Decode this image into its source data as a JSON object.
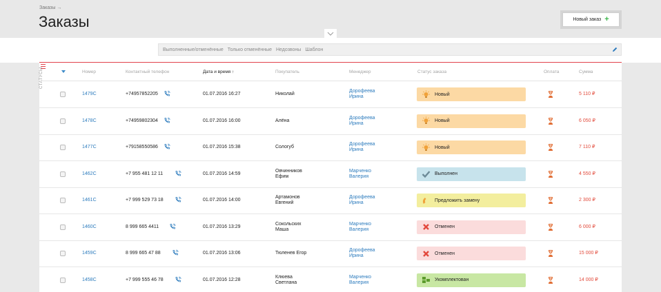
{
  "header": {
    "breadcrumb": "Заказы →",
    "title": "Заказы",
    "new_order_label": "Новый заказ"
  },
  "filters": {
    "tabs": [
      "Выполненные/отменённые",
      "Только отменённые",
      "Недозвоны",
      "Шаблон"
    ]
  },
  "sidebar": {
    "statuses_label": "СТАТУСЫ"
  },
  "table": {
    "headers": {
      "number": "Номер",
      "phone": "Контактный телефон",
      "datetime": "Дата и время ↑",
      "customer": "Покупатель",
      "manager": "Менеджер",
      "status": "Статус заказа",
      "payment": "Оплата",
      "sum": "Сумма"
    },
    "rows": [
      {
        "number": "1479C",
        "phone": "+74957852205",
        "datetime": "01.07.2016 16:27",
        "customer": [
          "Николай"
        ],
        "manager": [
          "Дорофеева",
          "Ирина"
        ],
        "status": "Новый",
        "status_type": "new",
        "sum": "5 110 ₽"
      },
      {
        "number": "1478C",
        "phone": "+74959802304",
        "datetime": "01.07.2016 16:00",
        "customer": [
          "Алёна"
        ],
        "manager": [
          "Дорофеева",
          "Ирина"
        ],
        "status": "Новый",
        "status_type": "new",
        "sum": "6 050 ₽"
      },
      {
        "number": "1477C",
        "phone": "+79158550586",
        "datetime": "01.07.2016 15:38",
        "customer": [
          "Сологуб"
        ],
        "manager": [
          "Дорофеева",
          "Ирина"
        ],
        "status": "Новый",
        "status_type": "new",
        "sum": "7 110 ₽"
      },
      {
        "number": "1462C",
        "phone": "+7 955 481 12 11",
        "datetime": "01.07.2016 14:59",
        "customer": [
          "Овчинников",
          "Ефим"
        ],
        "manager": [
          "Марченко",
          "Валерия"
        ],
        "status": "Выполнен",
        "status_type": "done",
        "sum": "4 550 ₽"
      },
      {
        "number": "1461C",
        "phone": "+7 999 529 73 18",
        "datetime": "01.07.2016 14:00",
        "customer": [
          "Артамонов",
          "Евгений"
        ],
        "manager": [
          "Дорофеева",
          "Ирина"
        ],
        "status": "Предложить замену",
        "status_type": "replace",
        "sum": "2 300 ₽"
      },
      {
        "number": "1460C",
        "phone": "8 999 665 4411",
        "datetime": "01.07.2016 13:29",
        "customer": [
          "Сокольских",
          "Маша"
        ],
        "manager": [
          "Марченко",
          "Валерия"
        ],
        "status": "Отменен",
        "status_type": "cancel",
        "sum": "6 000 ₽"
      },
      {
        "number": "1459C",
        "phone": "8 999 665 47 88",
        "datetime": "01.07.2016 13:06",
        "customer": [
          "Тюленев Егор"
        ],
        "manager": [
          "Дорофеева",
          "Ирина"
        ],
        "status": "Отменен",
        "status_type": "cancel",
        "sum": "15 000 ₽"
      },
      {
        "number": "1458C",
        "phone": "+7 999 555 46 78",
        "datetime": "01.07.2016 12:28",
        "customer": [
          "Клюева",
          "Светлана"
        ],
        "manager": [
          "Марченко",
          "Валерия"
        ],
        "status": "Укомплектован",
        "status_type": "packed",
        "sum": "14 000 ₽"
      }
    ]
  },
  "colors": {
    "accent_red": "#e1414b",
    "link_blue": "#2c7bbd",
    "sum_red": "#e24a3b",
    "status_new": "#fcd9a4",
    "status_done": "#c7e3ec",
    "status_replace": "#f3ee9e",
    "status_cancel": "#fbdcdc",
    "status_packed": "#c8e7a3"
  },
  "icons": {
    "phone": "phone-call-icon",
    "status_new": "lightbulb-icon",
    "status_done": "checkmark-icon",
    "status_replace": "handset-icon",
    "status_cancel": "cross-icon",
    "status_packed": "boxes-icon",
    "payment": "hourglass-icon"
  }
}
